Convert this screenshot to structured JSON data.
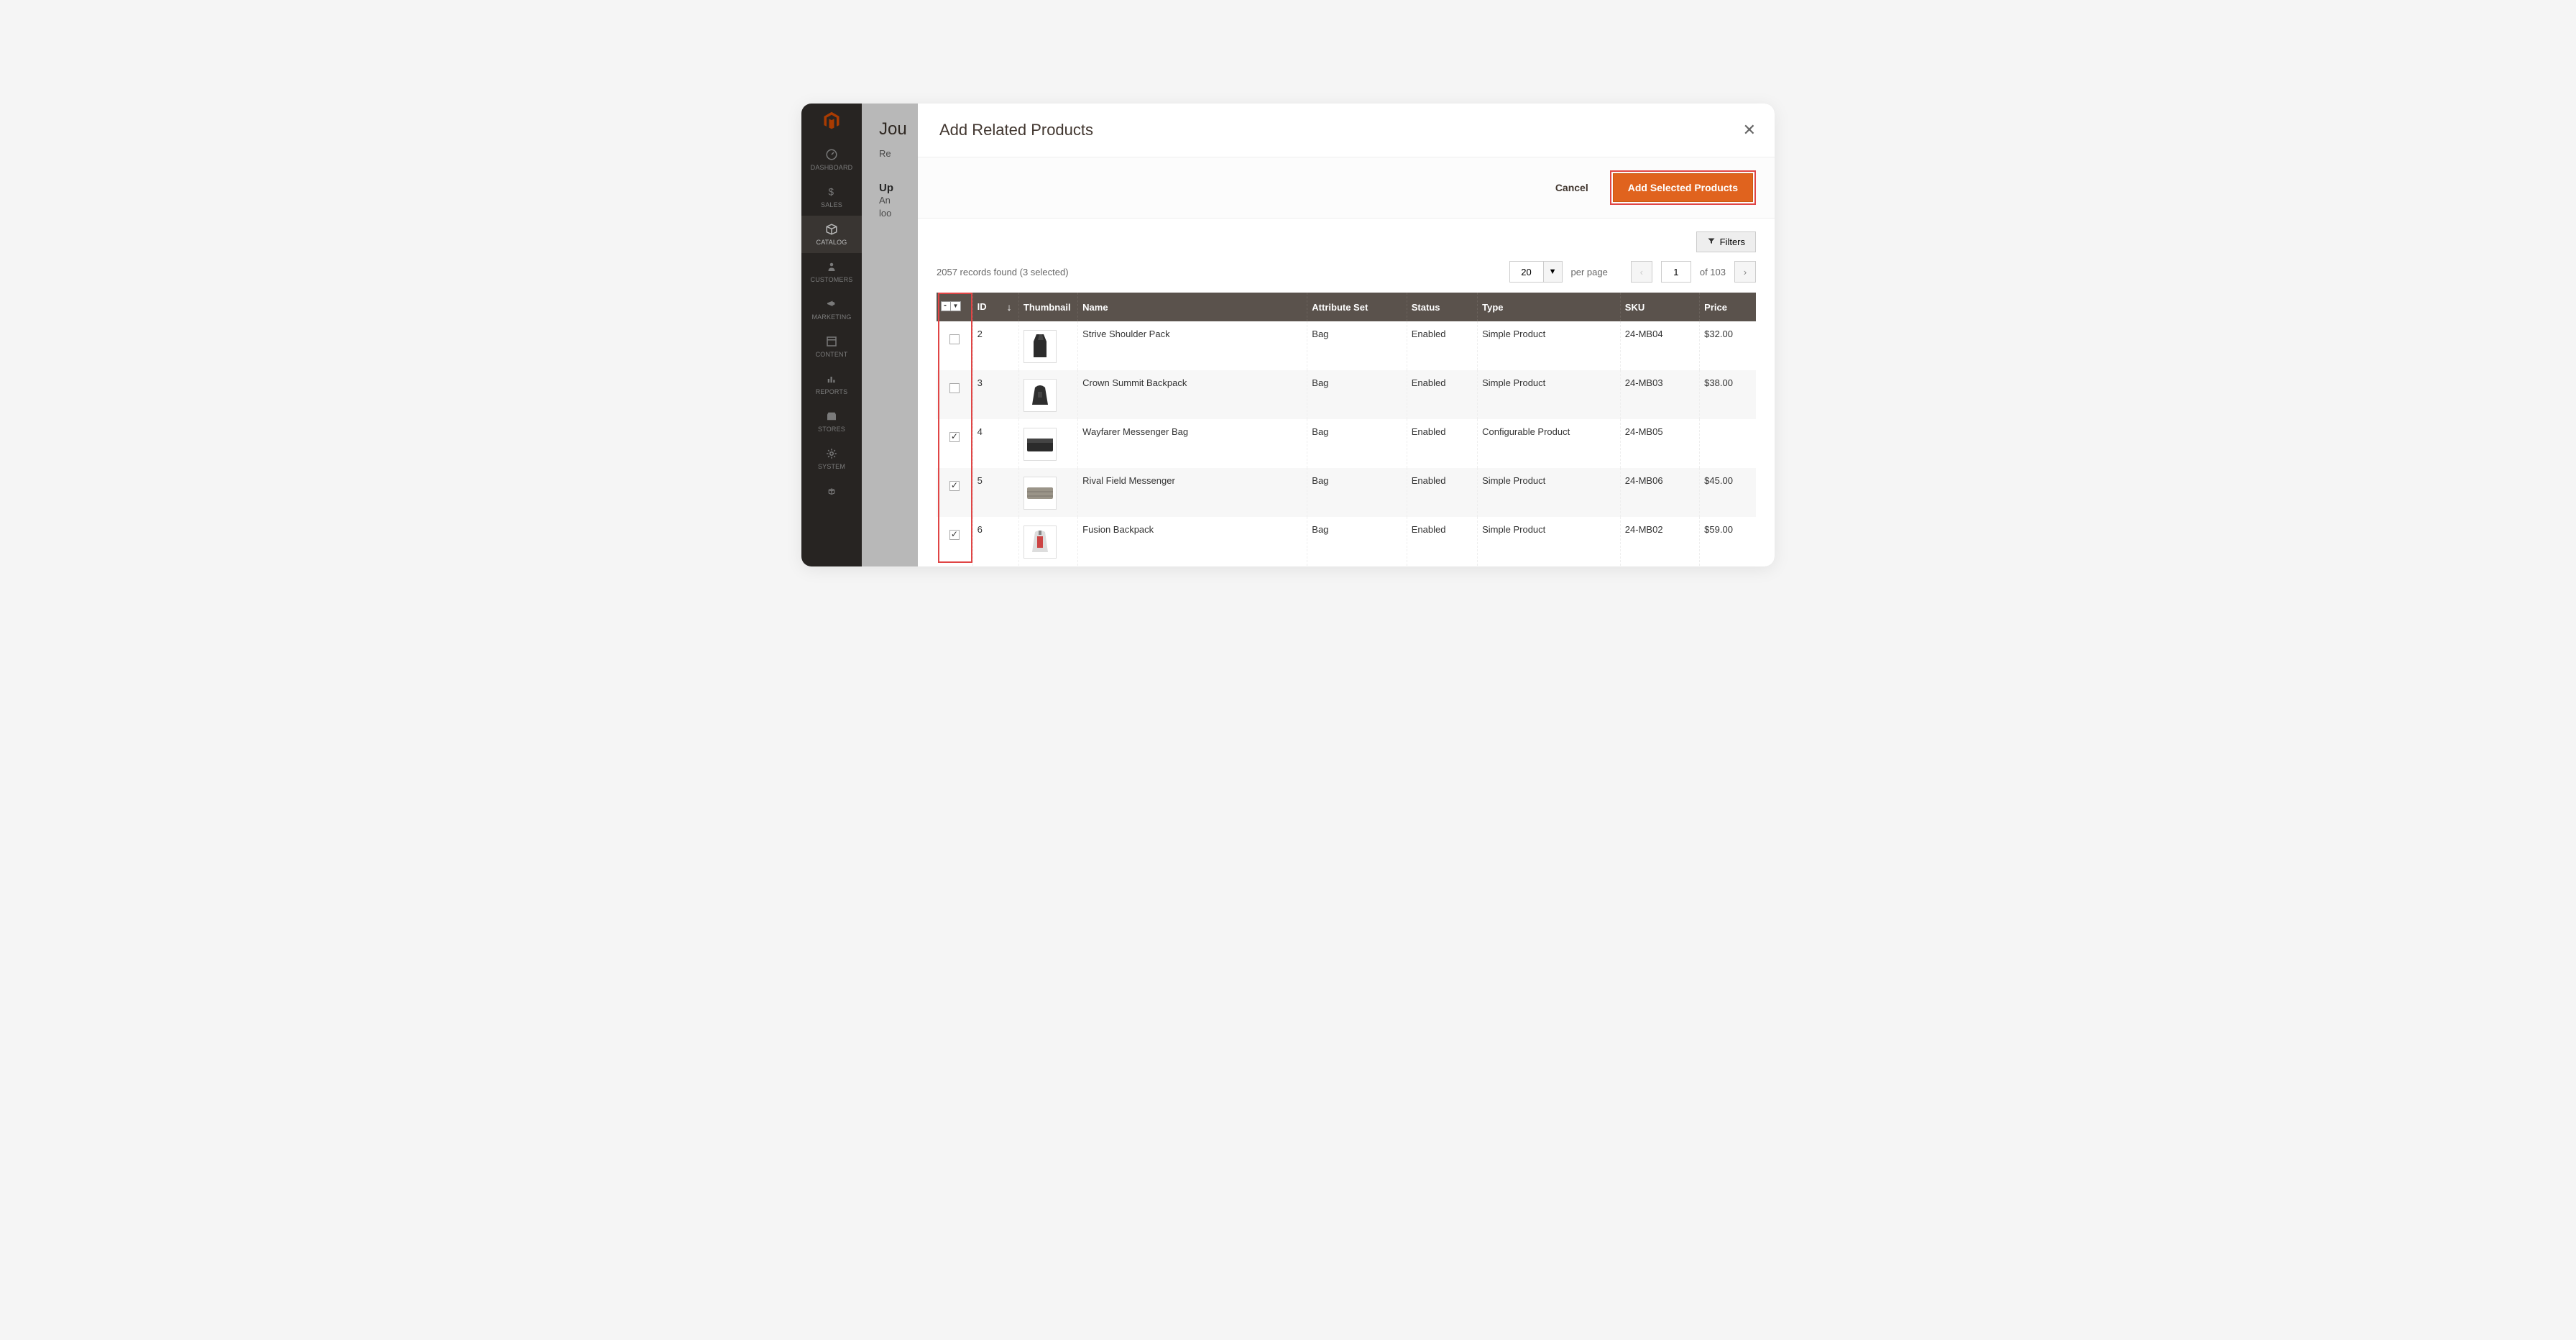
{
  "sidebar": {
    "items": [
      {
        "label": "DASHBOARD"
      },
      {
        "label": "SALES"
      },
      {
        "label": "CATALOG"
      },
      {
        "label": "CUSTOMERS"
      },
      {
        "label": "MARKETING"
      },
      {
        "label": "CONTENT"
      },
      {
        "label": "REPORTS"
      },
      {
        "label": "STORES"
      },
      {
        "label": "SYSTEM"
      }
    ]
  },
  "page": {
    "title_fragment": "Jou",
    "section_label": "Re",
    "subsection_title": "Up",
    "hint_line1": "An",
    "hint_line2": "loo"
  },
  "modal": {
    "title": "Add Related Products",
    "cancel_label": "Cancel",
    "submit_label": "Add Selected Products",
    "filters_label": "Filters",
    "records_text": "2057 records found (3 selected)",
    "page_size_value": "20",
    "per_page_label": "per page",
    "page_current": "1",
    "page_total_label": "of 103"
  },
  "columns": {
    "id": "ID",
    "thumbnail": "Thumbnail",
    "name": "Name",
    "attribute_set": "Attribute Set",
    "status": "Status",
    "type": "Type",
    "sku": "SKU",
    "price": "Price"
  },
  "rows": [
    {
      "checked": false,
      "id": "2",
      "name": "Strive Shoulder Pack",
      "attr": "Bag",
      "status": "Enabled",
      "type": "Simple Product",
      "sku": "24-MB04",
      "price": "$32.00"
    },
    {
      "checked": false,
      "id": "3",
      "name": "Crown Summit Backpack",
      "attr": "Bag",
      "status": "Enabled",
      "type": "Simple Product",
      "sku": "24-MB03",
      "price": "$38.00"
    },
    {
      "checked": true,
      "id": "4",
      "name": "Wayfarer Messenger Bag",
      "attr": "Bag",
      "status": "Enabled",
      "type": "Configurable Product",
      "sku": "24-MB05",
      "price": ""
    },
    {
      "checked": true,
      "id": "5",
      "name": "Rival Field Messenger",
      "attr": "Bag",
      "status": "Enabled",
      "type": "Simple Product",
      "sku": "24-MB06",
      "price": "$45.00"
    },
    {
      "checked": true,
      "id": "6",
      "name": "Fusion Backpack",
      "attr": "Bag",
      "status": "Enabled",
      "type": "Simple Product",
      "sku": "24-MB02",
      "price": "$59.00"
    }
  ]
}
